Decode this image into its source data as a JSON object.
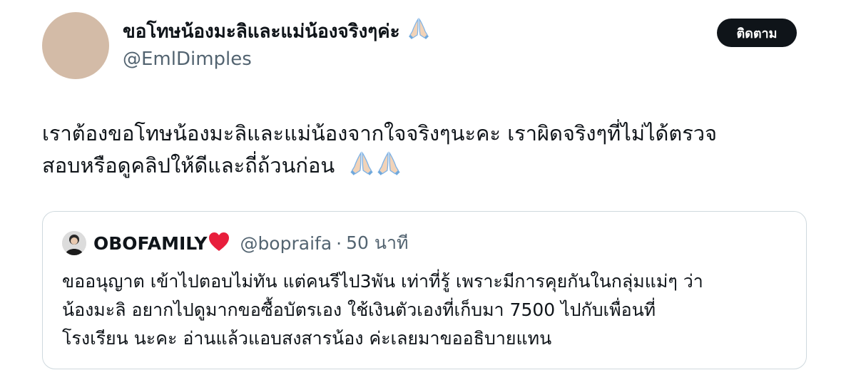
{
  "author": {
    "display_name": "ขอโทษน้องมะลิและแม่น้องจริงๆค่ะ",
    "name_emoji": "folded-hands-icon",
    "handle": "@EmlDimples",
    "avatar_color": "#d3bba7"
  },
  "follow_button": {
    "label": "ติดตาม"
  },
  "tweet": {
    "lines": [
      "เราต้องขอโทษน้องมะลิและแม่น้องจากใจจริงๆนะคะ เราผิดจริงๆที่ไม่ได้ตรวจ",
      "สอบหรือดูคลิปให้ดีและถี่ถ้วนก่อน"
    ],
    "trailing_emoji": [
      "folded-hands-icon",
      "folded-hands-icon"
    ]
  },
  "quote": {
    "name": "OBOFAMILY",
    "name_emoji": "red-heart-icon",
    "handle": "@bopraifa",
    "separator": "·",
    "time": "50 นาที",
    "lines": [
      "ขออนุญาต เข้าไปตอบไม่ทัน แต่คนรีไป3พัน เท่าที่รู้ เพราะมีการคุยกันในกลุ่มแม่ๆ ว่า",
      "น้องมะลิ อยากไปดูมากขอซื้อบัตรเอง ใช้เงินตัวเองที่เก็บมา 7500 ไปกับเพื่อนที่",
      "โรงเรียน นะคะ อ่านแล้วแอบสงสารน้อง ค่ะเลยมาขออธิบายแทน"
    ]
  },
  "colors": {
    "text_primary": "#0f1419",
    "text_secondary": "#536471",
    "border": "#cfd9de",
    "button_bg": "#0f1419",
    "heart": "#e0245e"
  }
}
